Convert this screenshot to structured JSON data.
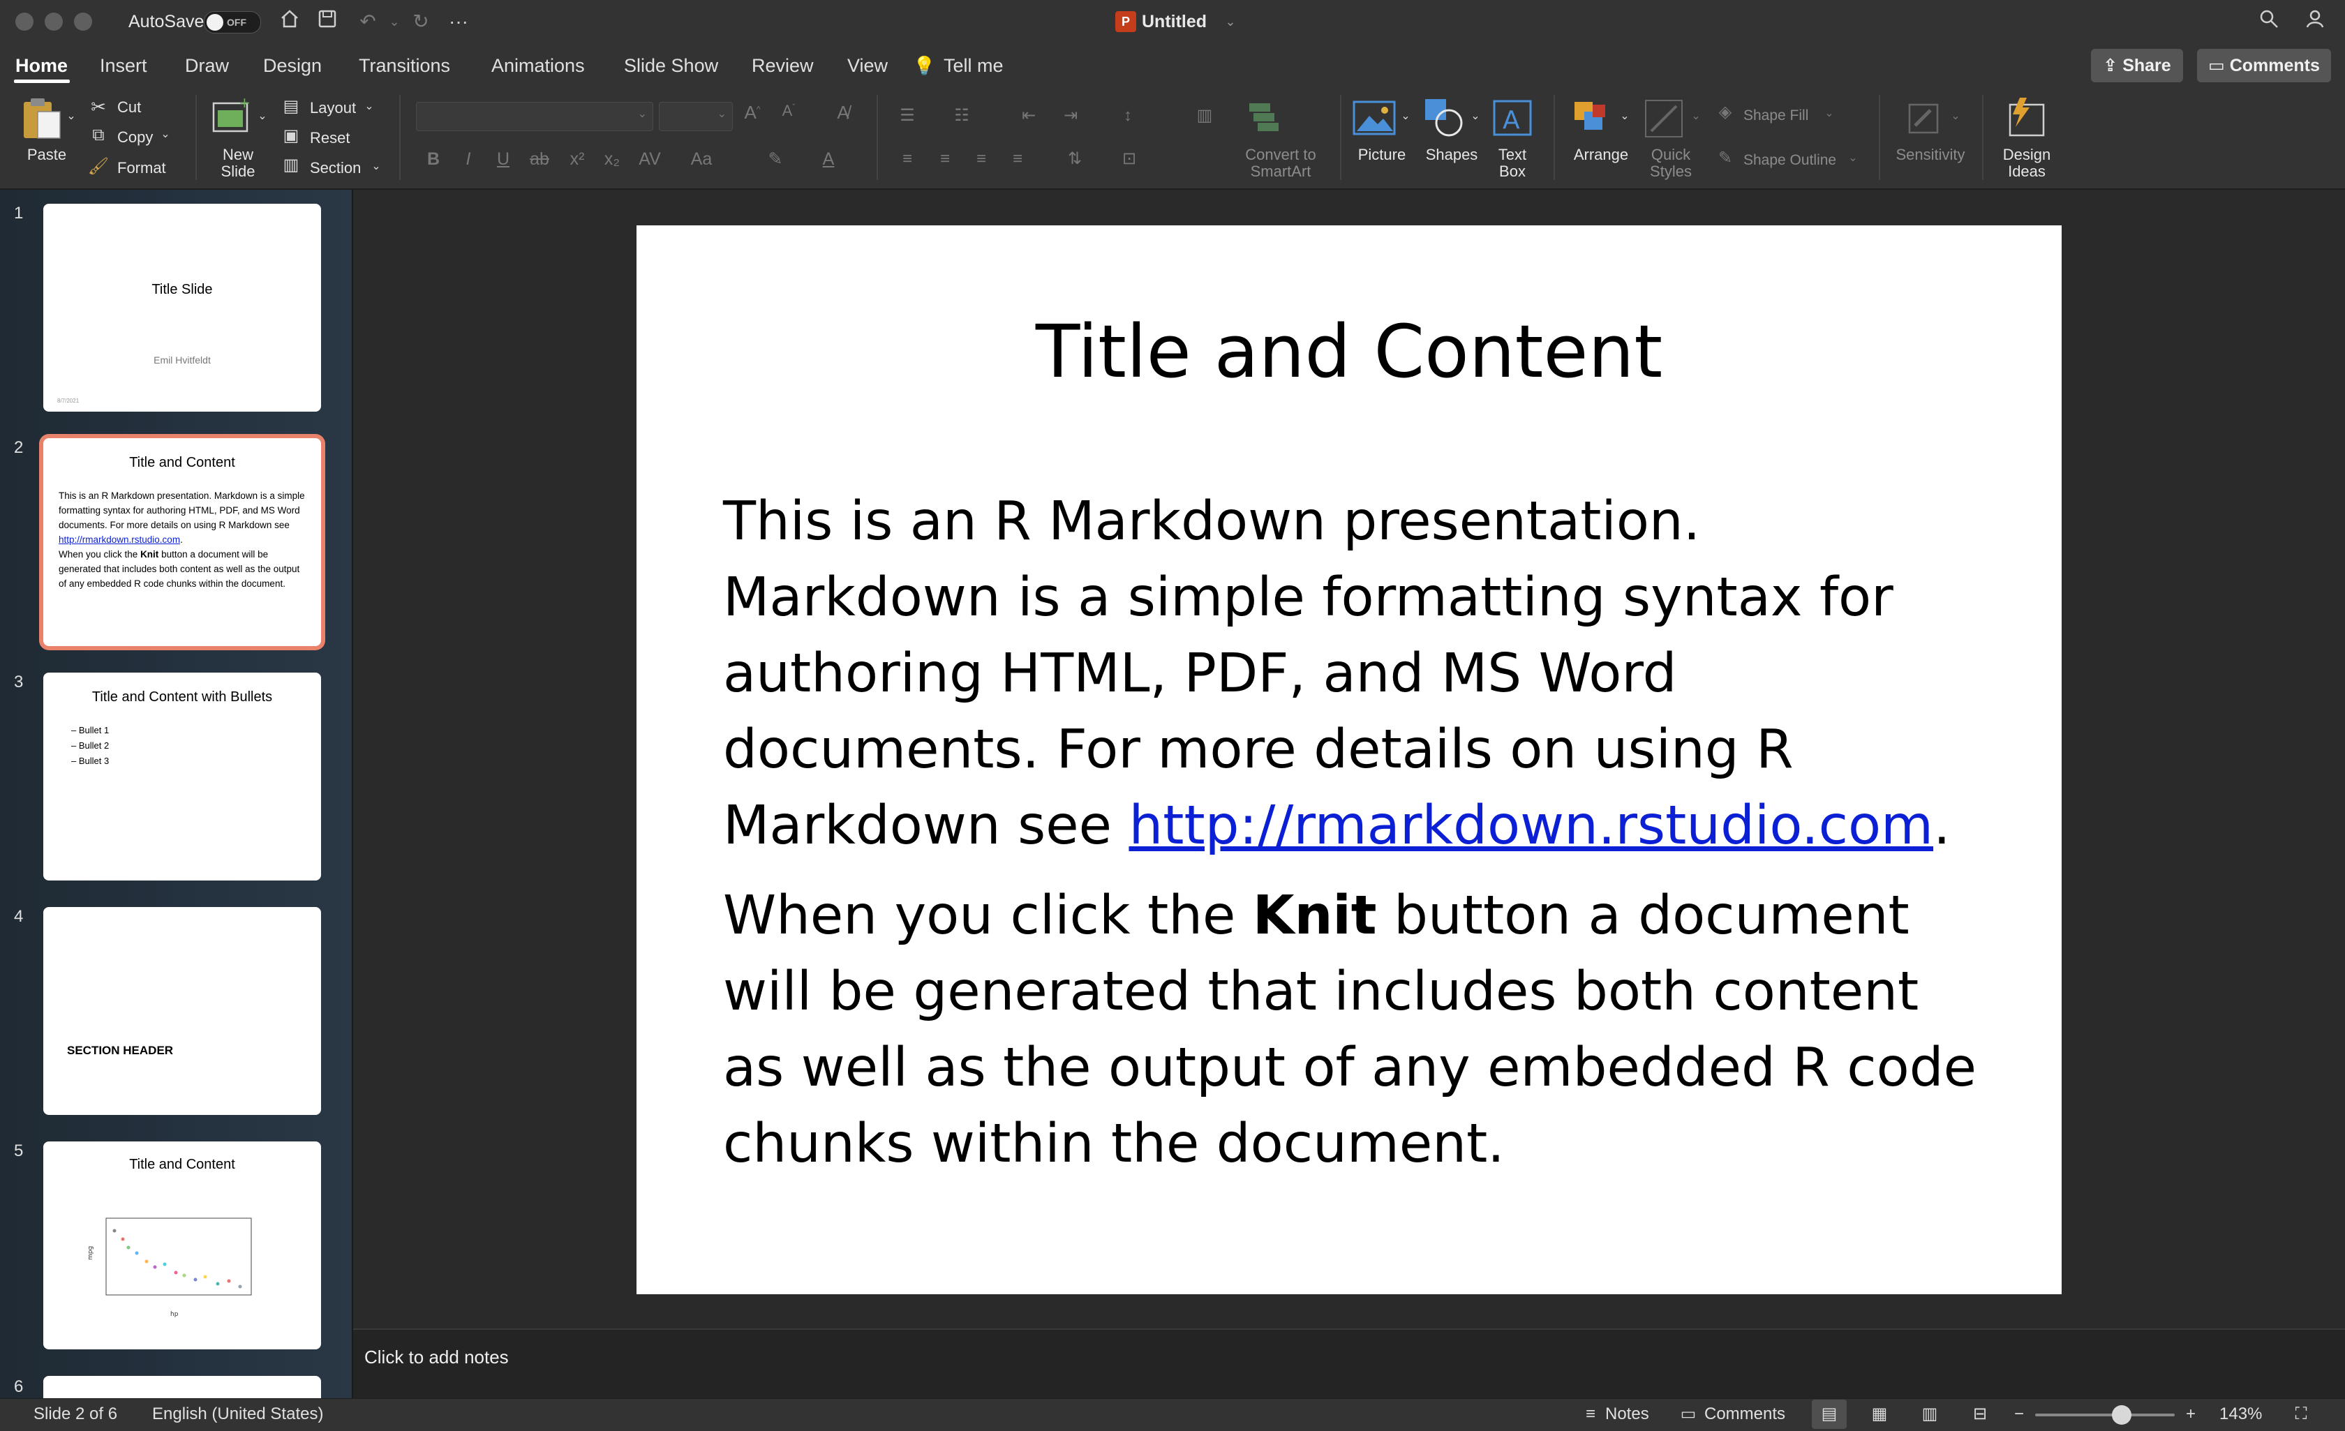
{
  "window": {
    "title": "Untitled",
    "autosave_label": "AutoSave",
    "autosave_state": "OFF"
  },
  "tabs": [
    "Home",
    "Insert",
    "Draw",
    "Design",
    "Transitions",
    "Animations",
    "Slide Show",
    "Review",
    "View",
    "Tell me"
  ],
  "header_buttons": {
    "share": "Share",
    "comments": "Comments"
  },
  "ribbon": {
    "paste": "Paste",
    "cut": "Cut",
    "copy": "Copy",
    "format": "Format",
    "new_slide_1": "New",
    "new_slide_2": "Slide",
    "layout": "Layout",
    "reset": "Reset",
    "section": "Section",
    "convert_1": "Convert to",
    "convert_2": "SmartArt",
    "picture": "Picture",
    "shapes": "Shapes",
    "textbox_1": "Text",
    "textbox_2": "Box",
    "arrange": "Arrange",
    "quick_styles_1": "Quick",
    "quick_styles_2": "Styles",
    "shape_fill": "Shape Fill",
    "shape_outline": "Shape Outline",
    "sensitivity": "Sensitivity",
    "design_ideas_1": "Design",
    "design_ideas_2": "Ideas"
  },
  "thumbnails": [
    {
      "number": "1",
      "title": "Title Slide",
      "subtitle": "Emil Hvitfeldt",
      "footer": "8/7/2021"
    },
    {
      "number": "2",
      "title": "Title and Content",
      "p1": "This is an R Markdown presentation. Markdown is a simple formatting syntax for authoring HTML, PDF, and MS Word documents. For more details on using R Markdown see",
      "link": "http://rmarkdown.rstudio.com",
      "p2_a": "When you click the ",
      "p2_bold": "Knit",
      "p2_b": " button a document will be generated that includes both content as well as the output of any embedded R code chunks within the document."
    },
    {
      "number": "3",
      "title": "Title and Content with Bullets",
      "bullets": [
        "Bullet 1",
        "Bullet 2",
        "Bullet 3"
      ]
    },
    {
      "number": "4",
      "title": "SECTION HEADER"
    },
    {
      "number": "5",
      "title": "Title and Content",
      "xlabel": "hp",
      "ylabel": "mpg"
    },
    {
      "number": "6",
      "title": ""
    }
  ],
  "slide": {
    "title": "Title and Content",
    "p1": "This is an R Markdown presentation. Markdown is a simple formatting syntax for authoring HTML, PDF, and MS Word documents. For more details on using R Markdown see",
    "link": "http://rmarkdown.rstudio.com",
    "p1_end": ".",
    "p2_a": "When you click the ",
    "p2_bold": "Knit",
    "p2_b": " button a document will be generated that includes both content as well as the output of any embedded R code chunks within the document."
  },
  "notes_placeholder": "Click to add notes",
  "status": {
    "slide_counter": "Slide 2 of 6",
    "language": "English (United States)",
    "notes": "Notes",
    "comments": "Comments",
    "zoom": "143%",
    "zoom_level": 0.62
  },
  "icons": {
    "home": "home-icon",
    "save": "save-icon",
    "undo": "undo-icon",
    "redo": "redo-icon",
    "more": "more-icon",
    "search": "search-icon",
    "account": "account-icon",
    "lightbulb": "lightbulb-icon"
  }
}
